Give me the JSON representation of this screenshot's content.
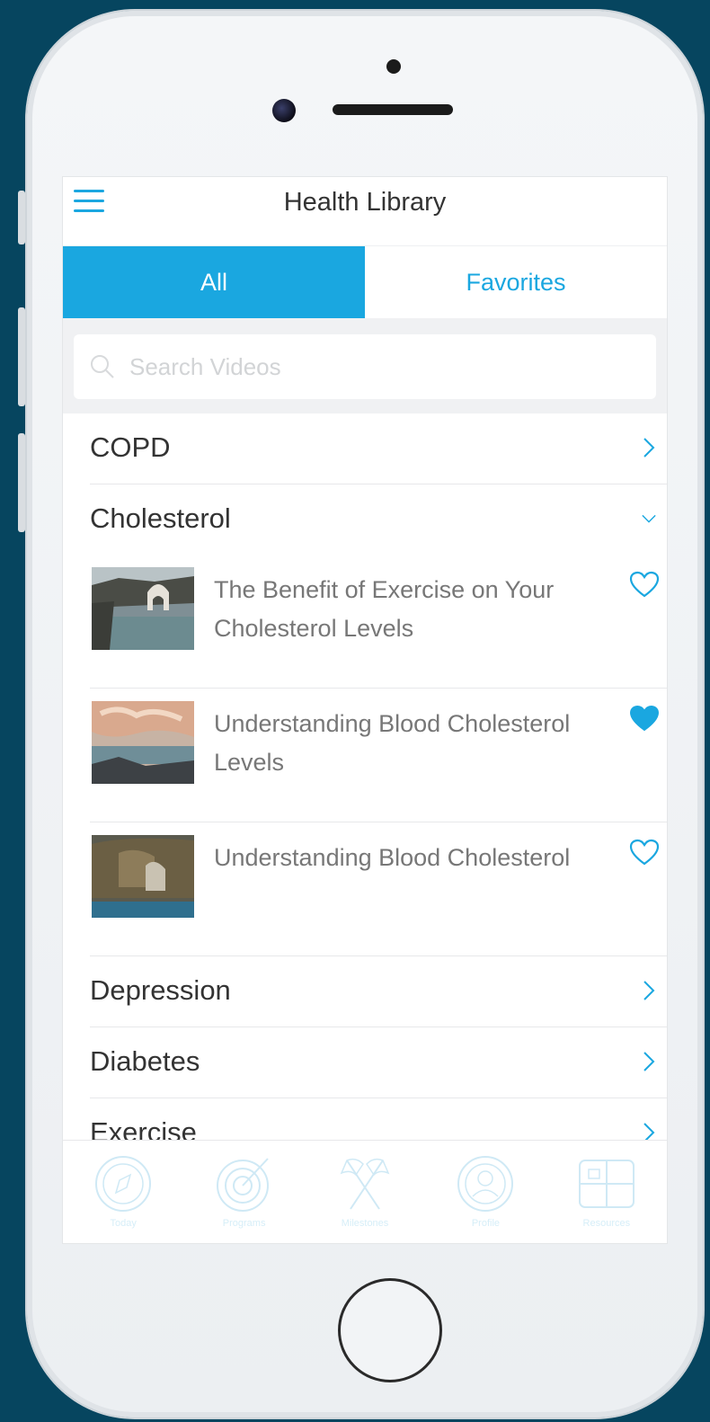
{
  "header": {
    "title": "Health Library"
  },
  "tabs": {
    "all": "All",
    "favorites": "Favorites"
  },
  "search": {
    "placeholder": "Search Videos"
  },
  "categories_top": [
    {
      "label": "COPD"
    }
  ],
  "expanded_category": {
    "label": "Cholesterol",
    "videos": [
      {
        "title": "The Benefit of Exercise on Your Cholesterol Levels",
        "favorite": false
      },
      {
        "title": "Understanding Blood Cholesterol Levels",
        "favorite": true
      },
      {
        "title": "Understanding Blood Cholesterol",
        "favorite": false
      }
    ]
  },
  "categories_bottom": [
    {
      "label": "Depression"
    },
    {
      "label": "Diabetes"
    },
    {
      "label": "Exercise"
    }
  ],
  "tabbar": {
    "items": [
      {
        "icon": "compass-icon",
        "label": "Today"
      },
      {
        "icon": "target-icon",
        "label": "Programs"
      },
      {
        "icon": "flags-icon",
        "label": "Milestones"
      },
      {
        "icon": "profile-icon",
        "label": "Profile"
      },
      {
        "icon": "library-icon",
        "label": "Resources"
      }
    ]
  },
  "colors": {
    "accent": "#1aa7e0",
    "frame_bg": "#06455f"
  }
}
